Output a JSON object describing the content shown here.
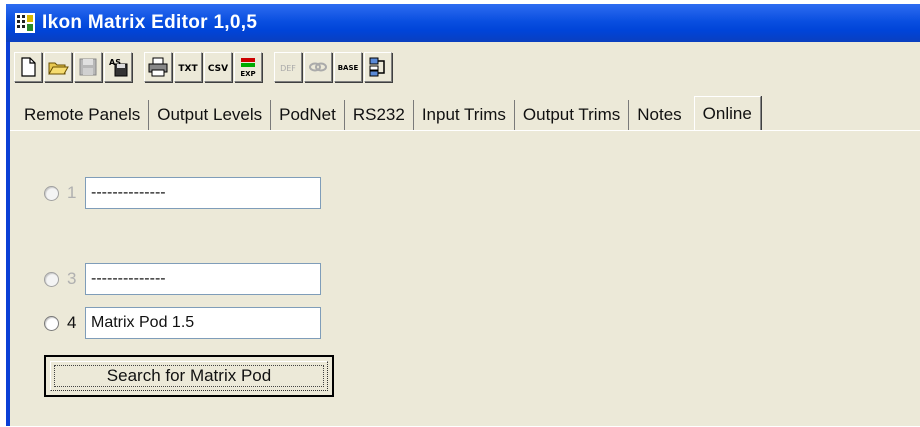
{
  "window": {
    "title": "Ikon Matrix Editor 1,0,5"
  },
  "toolbar": {
    "buttons": [
      {
        "icon": "new-file-icon",
        "enabled": true
      },
      {
        "icon": "open-folder-icon",
        "enabled": true
      },
      {
        "icon": "save-icon",
        "enabled": false
      },
      {
        "icon": "save-as-icon",
        "enabled": true
      },
      {
        "icon": "print-icon",
        "enabled": true
      },
      {
        "label": "TXT",
        "icon": "export-txt-icon",
        "enabled": true
      },
      {
        "label": "CSV",
        "icon": "export-csv-icon",
        "enabled": true
      },
      {
        "label": "EXP",
        "icon": "export-icon",
        "enabled": true
      },
      {
        "label": "DEF",
        "icon": "default-icon",
        "enabled": false
      },
      {
        "icon": "link-icon",
        "enabled": false
      },
      {
        "label": "BASE",
        "icon": "base-icon",
        "enabled": true
      },
      {
        "icon": "network-icon",
        "enabled": true
      }
    ]
  },
  "tabs": [
    {
      "label": "Remote Panels"
    },
    {
      "label": "Output Levels"
    },
    {
      "label": "PodNet"
    },
    {
      "label": "RS232"
    },
    {
      "label": "Input Trims"
    },
    {
      "label": "Output Trims"
    },
    {
      "label": "Notes"
    },
    {
      "label": "Online",
      "active": true
    }
  ],
  "pods": [
    {
      "number": "1",
      "value": "--------------",
      "enabled": false
    },
    {
      "number": "3",
      "value": "--------------",
      "enabled": false
    },
    {
      "number": "4",
      "value": "Matrix Pod 1.5",
      "enabled": true
    }
  ],
  "search_button": {
    "label": "Search for Matrix Pod"
  },
  "colors": {
    "titlebar": "#0a4fe0",
    "face": "#ece9d8",
    "window_border": "#0a3fd6"
  }
}
